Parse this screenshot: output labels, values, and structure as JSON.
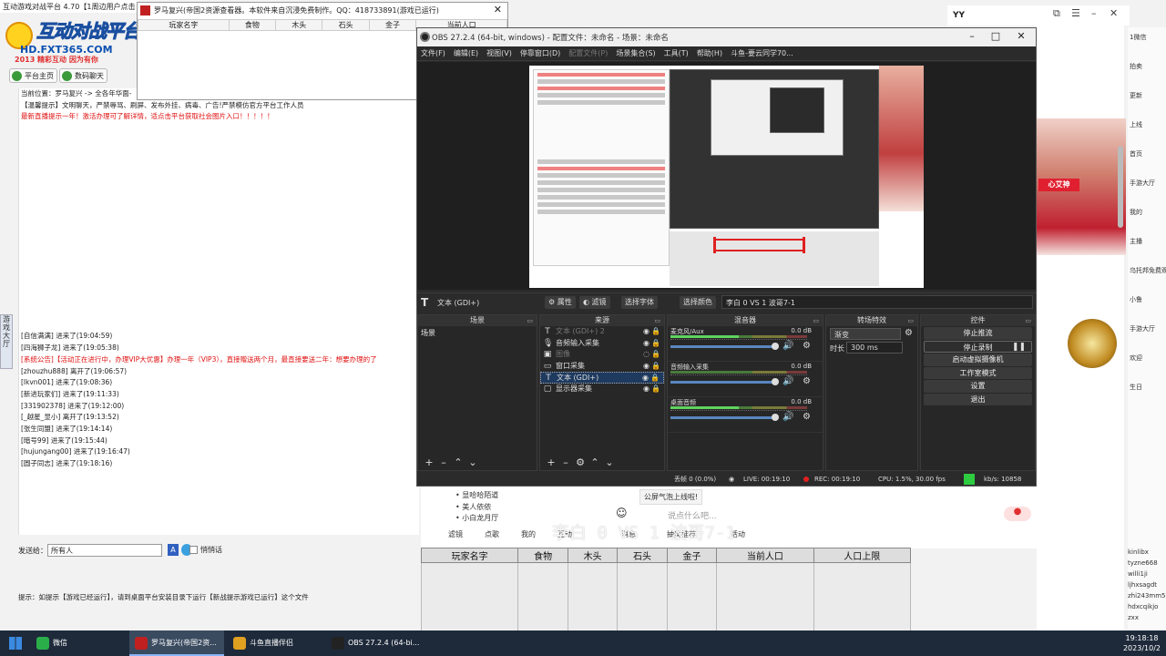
{
  "left_app": {
    "title": "互动游戏对战平台 4.70【1周边用户点击",
    "logo_main": "互动对战平台",
    "logo_url": "HD.FXT365.COM",
    "logo_slogan": "2013 精彩互动 因为有你",
    "nav": [
      "平台主页",
      "数码聊天"
    ],
    "chat_lines": [
      {
        "text": "当前位置：罗马复兴 -> 全各年华面-",
        "red": false
      },
      {
        "text": "【温馨提示】文明聊天，严禁辱骂、刷屏、发布外挂、病毒、广告!严禁模仿官方平台工作人员",
        "red": false
      },
      {
        "text": "最新直播提示一年！激活办理可了解详情，适点击平台获取社会图片入口！！！！！",
        "red": true
      },
      {
        "text": "",
        "red": false
      },
      {
        "text": "",
        "red": false
      },
      {
        "text": "",
        "red": false
      },
      {
        "text": "",
        "red": false
      },
      {
        "text": "",
        "red": false
      },
      {
        "text": "",
        "red": false
      },
      {
        "text": "",
        "red": false
      },
      {
        "text": "",
        "red": false
      },
      {
        "text": "",
        "red": false
      },
      {
        "text": "",
        "red": false
      },
      {
        "text": "",
        "red": false
      },
      {
        "text": "",
        "red": false
      },
      {
        "text": "",
        "red": false
      },
      {
        "text": "",
        "red": false
      },
      {
        "text": "",
        "red": false
      },
      {
        "text": "",
        "red": false
      },
      {
        "text": "",
        "red": false
      },
      {
        "text": "",
        "red": false
      },
      {
        "text": "[自信满满] 进来了(19:04:59)",
        "red": false
      },
      {
        "text": "[四海狮子龙] 进来了(19:05:38)",
        "red": false
      },
      {
        "text": "[系统公告]【活动正在进行中，办理VIP大优惠】办理一年（VIP3），直接赠送两个月，最直接要送二年：想要办理的了",
        "red": true
      },
      {
        "text": "[zhouzhu888] 离开了(19:06:57)",
        "red": false
      },
      {
        "text": "[lkvn001] 进来了(19:08:36)",
        "red": false
      },
      {
        "text": "[新进玩家们] 进来了(19:11:33)",
        "red": false
      },
      {
        "text": "[331902378] 进来了(19:12:00)",
        "red": false
      },
      {
        "text": "[_越星_显小] 离开了(19:13:52)",
        "red": false
      },
      {
        "text": "[张生同盟] 进来了(19:14:14)",
        "red": false
      },
      {
        "text": "[暗号99] 进来了(19:15:44)",
        "red": false
      },
      {
        "text": "[hujungang00] 进来了(19:16:47)",
        "red": false
      },
      {
        "text": "[圆子同志] 进来了(19:18:16)",
        "red": false
      }
    ],
    "send_label": "发送给：",
    "send_target": "所有人",
    "private_label": "悄悄话",
    "hint": "提示：如提示【游戏已经运行】，请到桌面平台安装目录下运行【新战提示游戏已运行】这个文件",
    "side_strip": "游戏大厅"
  },
  "game_window": {
    "title": "罗马复兴(帝国2资源查看器。本软件来自沉浸免费制作。QQ：418733891(游戏已运行)",
    "columns": [
      "玩家名字",
      "食物",
      "木头",
      "石头",
      "金子",
      "当前人口"
    ]
  },
  "obs": {
    "title": "OBS 27.2.4 (64-bit, windows) - 配置文件：未命名 - 场景：未命名",
    "menu": [
      {
        "label": "文件(F)",
        "disabled": false
      },
      {
        "label": "编辑(E)",
        "disabled": false
      },
      {
        "label": "视图(V)",
        "disabled": false
      },
      {
        "label": "停靠窗口(D)",
        "disabled": false
      },
      {
        "label": "配置文件(P)",
        "disabled": true
      },
      {
        "label": "场景集合(S)",
        "disabled": false
      },
      {
        "label": "工具(T)",
        "disabled": false
      },
      {
        "label": "帮助(H)",
        "disabled": false
      },
      {
        "label": "斗鱼-要云同学70...",
        "disabled": false
      }
    ],
    "context": {
      "source_label": "文本 (GDI+)",
      "properties": "属性",
      "filters": "滤镜",
      "select_font": "选择字体",
      "select_color": "选择颜色",
      "text_value": "李白 0 VS 1 波哥7-1"
    },
    "docks": {
      "scenes": "场景",
      "sources": "来源",
      "mixer": "混音器",
      "transitions": "转场特效",
      "controls": "控件"
    },
    "scene_list": [
      "场景"
    ],
    "sources_list": [
      {
        "name": "文本 (GDI+) 2",
        "icon": "text-icon",
        "glyph": "T",
        "visible": true,
        "dim": true,
        "selected": false
      },
      {
        "name": "音频输入采集",
        "icon": "mic-icon",
        "glyph": "🎙",
        "visible": true,
        "dim": false,
        "selected": false
      },
      {
        "name": "图像",
        "icon": "image-icon",
        "glyph": "▣",
        "visible": false,
        "dim": true,
        "selected": false
      },
      {
        "name": "窗口采集",
        "icon": "window-icon",
        "glyph": "▭",
        "visible": true,
        "dim": false,
        "selected": false
      },
      {
        "name": "文本 (GDI+)",
        "icon": "text-icon",
        "glyph": "T",
        "visible": true,
        "dim": false,
        "selected": true
      },
      {
        "name": "显示器采集",
        "icon": "monitor-icon",
        "glyph": "▢",
        "visible": true,
        "dim": false,
        "selected": false
      }
    ],
    "mixer": [
      {
        "name": "麦克风/Aux",
        "db": "0.0 dB",
        "live": true
      },
      {
        "name": "音频输入采集",
        "db": "0.0 dB",
        "live": false
      },
      {
        "name": "桌面音频",
        "db": "0.0 dB",
        "live": true
      }
    ],
    "transition": {
      "name": "渐变",
      "duration_label": "时长",
      "duration": "300 ms"
    },
    "controls": [
      "停止推流",
      "停止录制",
      "启动虚拟摄像机",
      "工作室模式",
      "设置",
      "退出"
    ],
    "status": {
      "dropped": "丢帧 0 (0.0%)",
      "live": "LIVE: 00:19:10",
      "rec": "REC: 00:19:10",
      "cpu": "CPU: 1.5%, 30.00 fps",
      "kbps": "kb/s: 10858"
    }
  },
  "right_browser": {
    "title": "YY",
    "items": [
      "1微信",
      "拍卖",
      "更新",
      "上线",
      "首页",
      "手游大厅",
      "我的",
      "主播",
      "乌托邦免费观",
      "小鲁",
      "手游大厅",
      "欢迎",
      "生日"
    ],
    "badge": "心艾神",
    "people": [
      "kinlibx",
      "tyzne668",
      "willi1ji",
      "ljhxsagdt",
      "zhi243mm5",
      "hdxcqikjo",
      "zxx"
    ]
  },
  "stream_panel": {
    "list": [
      "显哈哈陌道",
      "美人依依",
      "小白龙月厅"
    ],
    "bubble": "公屏气泡上线啦!",
    "input_placeholder": "说点什么吧...",
    "tools": [
      "滤镜",
      "点歌",
      "我的",
      "互动",
      "消息",
      "抽奖推荐",
      "活动"
    ],
    "overlay": "李白 0 VS 1 波哥7-1"
  },
  "bottom_table": {
    "columns": [
      "玩家名字",
      "食物",
      "木头",
      "石头",
      "金子",
      "当前人口",
      "人口上限"
    ]
  },
  "taskbar": {
    "items": [
      {
        "label": "微信",
        "active": false
      },
      {
        "label": "罗马复兴(帝国2资...",
        "active": true
      },
      {
        "label": "斗鱼直播伴侣",
        "active": false
      },
      {
        "label": "OBS 27.2.4 (64-bi...",
        "active": false
      }
    ],
    "time": "19:18:18",
    "date": "2023/10/2"
  }
}
